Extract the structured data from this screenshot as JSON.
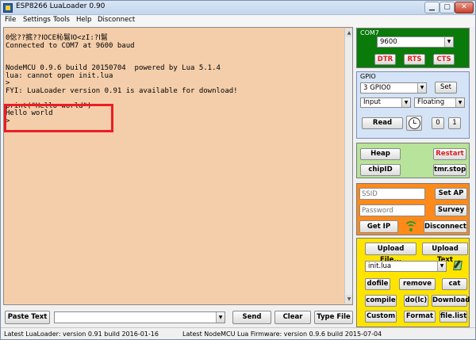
{
  "window": {
    "title": "ESP8266 LuaLoader 0.90"
  },
  "menu": [
    "File",
    "Settings",
    "Tools",
    "Help",
    "Disconnect"
  ],
  "terminal": {
    "lines": [
      "0倊??掋??ⅠOCE杺鬄ⅠO<zI:?Ⅰ鬄",
      "Connected to COM7 at 9600 baud",
      "",
      "",
      "NodeMCU 0.9.6 build 20150704  powered by Lua 5.1.4",
      "lua: cannot open init.lua",
      ">",
      "FYI: LuaLoader version 0.91 is available for download!",
      "",
      "print(\"Hello world\")",
      "Hello world",
      ">"
    ]
  },
  "bottom_bar": {
    "paste_text": "Paste Text",
    "input_value": "",
    "send": "Send",
    "clear": "Clear",
    "type_file": "Type File"
  },
  "status": {
    "left": "Latest LuaLoader:  version 0.91  build 2016-01-16",
    "right": "Latest NodeMCU Lua Firmware:  version 0.9.6 build 2015-07-04"
  },
  "com_panel": {
    "title": "COM7",
    "baud": "9600",
    "dtr": "DTR",
    "rts": "RTS",
    "cts": "CTS"
  },
  "gpio_panel": {
    "title": "GPIO",
    "pin": "3 GPIO0",
    "set": "Set",
    "mode": "Input",
    "pull": "Floating",
    "read": "Read",
    "zero": "0",
    "one": "1"
  },
  "heap_panel": {
    "heap": "Heap",
    "restart": "Restart",
    "chipid": "chipID",
    "tmrstop": "tmr.stop"
  },
  "wifi_panel": {
    "ssid_placeholder": "SSID",
    "password_placeholder": "Password",
    "set_ap": "Set AP",
    "survey": "Survey",
    "get_ip": "Get IP",
    "disconnect": "Disconnect"
  },
  "files_panel": {
    "upload_file": "Upload File...",
    "upload_text": "Upload Text",
    "file": "init.lua",
    "dofile": "dofile",
    "remove": "remove",
    "cat": "cat",
    "compile": "compile",
    "dolc": "do(lc)",
    "download": "Download",
    "custom": "Custom",
    "format": "Format",
    "file_list": "file.list"
  },
  "colors": {
    "terminal_bg": "#f4ceaa",
    "highlight": "#ee1c24",
    "com_panel": "#0a7a0a",
    "gpio_panel": "#d4e3f5",
    "heap_panel": "#b7e39a",
    "wifi_panel": "#ff8a1a",
    "files_panel": "#ffe400",
    "red_text": "#d81e1e"
  }
}
